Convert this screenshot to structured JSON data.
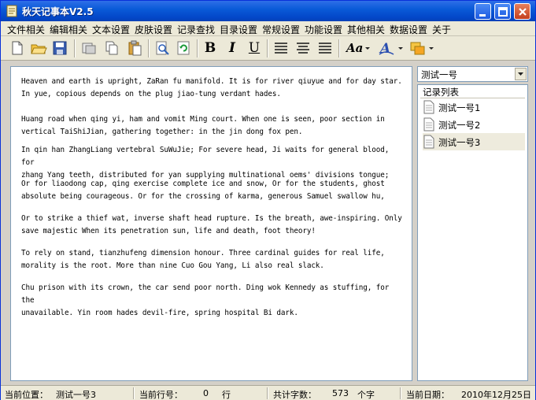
{
  "window": {
    "title": "秋天记事本V2.5"
  },
  "menu": [
    "文件相关",
    "编辑相关",
    "文本设置",
    "皮肤设置",
    "记录查找",
    "目录设置",
    "常规设置",
    "功能设置",
    "其他相关",
    "数据设置",
    "关于"
  ],
  "toolbar": {
    "icons": [
      "new-document-icon",
      "open-folder-icon",
      "save-disk-icon",
      "cut-icon",
      "copy-icon",
      "paste-icon",
      "find-icon",
      "refresh-icon",
      "bold-icon",
      "italic-icon",
      "underline-icon",
      "align-left-icon",
      "align-center-icon",
      "align-right-icon",
      "font-size-icon",
      "font-color-icon",
      "background-color-icon"
    ],
    "bold": "B",
    "italic": "I",
    "underline": "U",
    "font_label": "Aa"
  },
  "editor": {
    "paragraphs": [
      "Heaven and earth is upright, ZaRan fu manifold. It is for river qiuyue and for day star.\nIn yue, copious depends on the plug jiao-tung verdant hades.",
      "Huang road when qing yi, ham and vomit Ming court. When one is seen, poor section in\nvertical TaiShiJian, gathering together: in the jin dong fox pen.",
      "In qin han ZhangLiang vertebral SuWuJie; For severe head, Ji waits for general blood, for\nzhang Yang teeth, distributed for yan supplying multinational oems' divisions tongue;",
      "Or for liaodong cap, qing exercise complete ice and snow, Or for the students, ghost\nabsolute being courageous. Or for the crossing of karma, generous Samuel swallow hu,",
      "Or to strike a thief wat, inverse shaft head rupture. Is the breath, awe-inspiring. Only\nsave majestic When its penetration sun, life and death, foot theory!",
      "To rely on stand, tianzhufeng dimension honour. Three cardinal guides for real life,\nmorality is the root. More than nine Cuo Gou Yang, Li also real slack.",
      "Chu prison with its crown, the car send poor north. Ding wok Kennedy as stuffing, for the\nunavailable. Yin room hades devil-fire, spring hospital Bi dark."
    ]
  },
  "sidebar": {
    "selected_category": "测试一号",
    "list_header": "记录列表",
    "items": [
      "测试一号1",
      "测试一号2",
      "测试一号3"
    ]
  },
  "status": {
    "position_label": "当前位置：",
    "position_value": "测试一号3",
    "line_label": "当前行号：",
    "line_value": "0",
    "line_unit": "行",
    "count_label": "共计字数：",
    "count_value": "573",
    "count_unit": "个字",
    "date_label": "当前日期：",
    "date_value": "2010年12月25日"
  },
  "colors": {
    "titlebar": "#0a5bd8",
    "menubar": "#ece9d8",
    "selected_item": "#eeebdd",
    "border": "#7f9db9"
  }
}
